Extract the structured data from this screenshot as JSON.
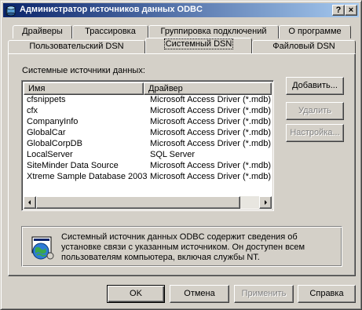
{
  "window": {
    "title": "Администратор источников данных ODBC",
    "help_label": "?",
    "close_label": "×"
  },
  "tabs_back": [
    {
      "label": "Драйверы"
    },
    {
      "label": "Трассировка"
    },
    {
      "label": "Группировка подключений"
    },
    {
      "label": "О программе"
    }
  ],
  "tabs_front": [
    {
      "label": "Пользовательский DSN"
    },
    {
      "label": "Системный DSN"
    },
    {
      "label": "Файловый DSN"
    }
  ],
  "panel": {
    "group_label": "Системные источники данных:",
    "columns": [
      "Имя",
      "Драйвер"
    ],
    "rows": [
      {
        "name": "cfsnippets",
        "driver": "Microsoft Access Driver (*.mdb)"
      },
      {
        "name": "cfx",
        "driver": "Microsoft Access Driver (*.mdb)"
      },
      {
        "name": "CompanyInfo",
        "driver": "Microsoft Access Driver (*.mdb)"
      },
      {
        "name": "GlobalCar",
        "driver": "Microsoft Access Driver (*.mdb)"
      },
      {
        "name": "GlobalCorpDB",
        "driver": "Microsoft Access Driver (*.mdb)"
      },
      {
        "name": "LocalServer",
        "driver": "SQL Server"
      },
      {
        "name": "SiteMinder Data Source",
        "driver": "Microsoft Access Driver (*.mdb)"
      },
      {
        "name": "Xtreme Sample Database 2003",
        "driver": "Microsoft Access Driver (*.mdb)"
      }
    ],
    "add_button": "Добавить...",
    "delete_button": "Удалить",
    "configure_button": "Настройка...",
    "info_text": "Системный источник данных ODBC содержит сведения об установке связи с указанным источником. Он доступен всем пользователям компьютера, включая службы NT."
  },
  "footer": {
    "ok": "OK",
    "cancel": "Отмена",
    "apply": "Применить",
    "help": "Справка"
  },
  "colors": {
    "title_start": "#0a246a",
    "title_end": "#a6caf0",
    "face": "#d4d0c8"
  }
}
